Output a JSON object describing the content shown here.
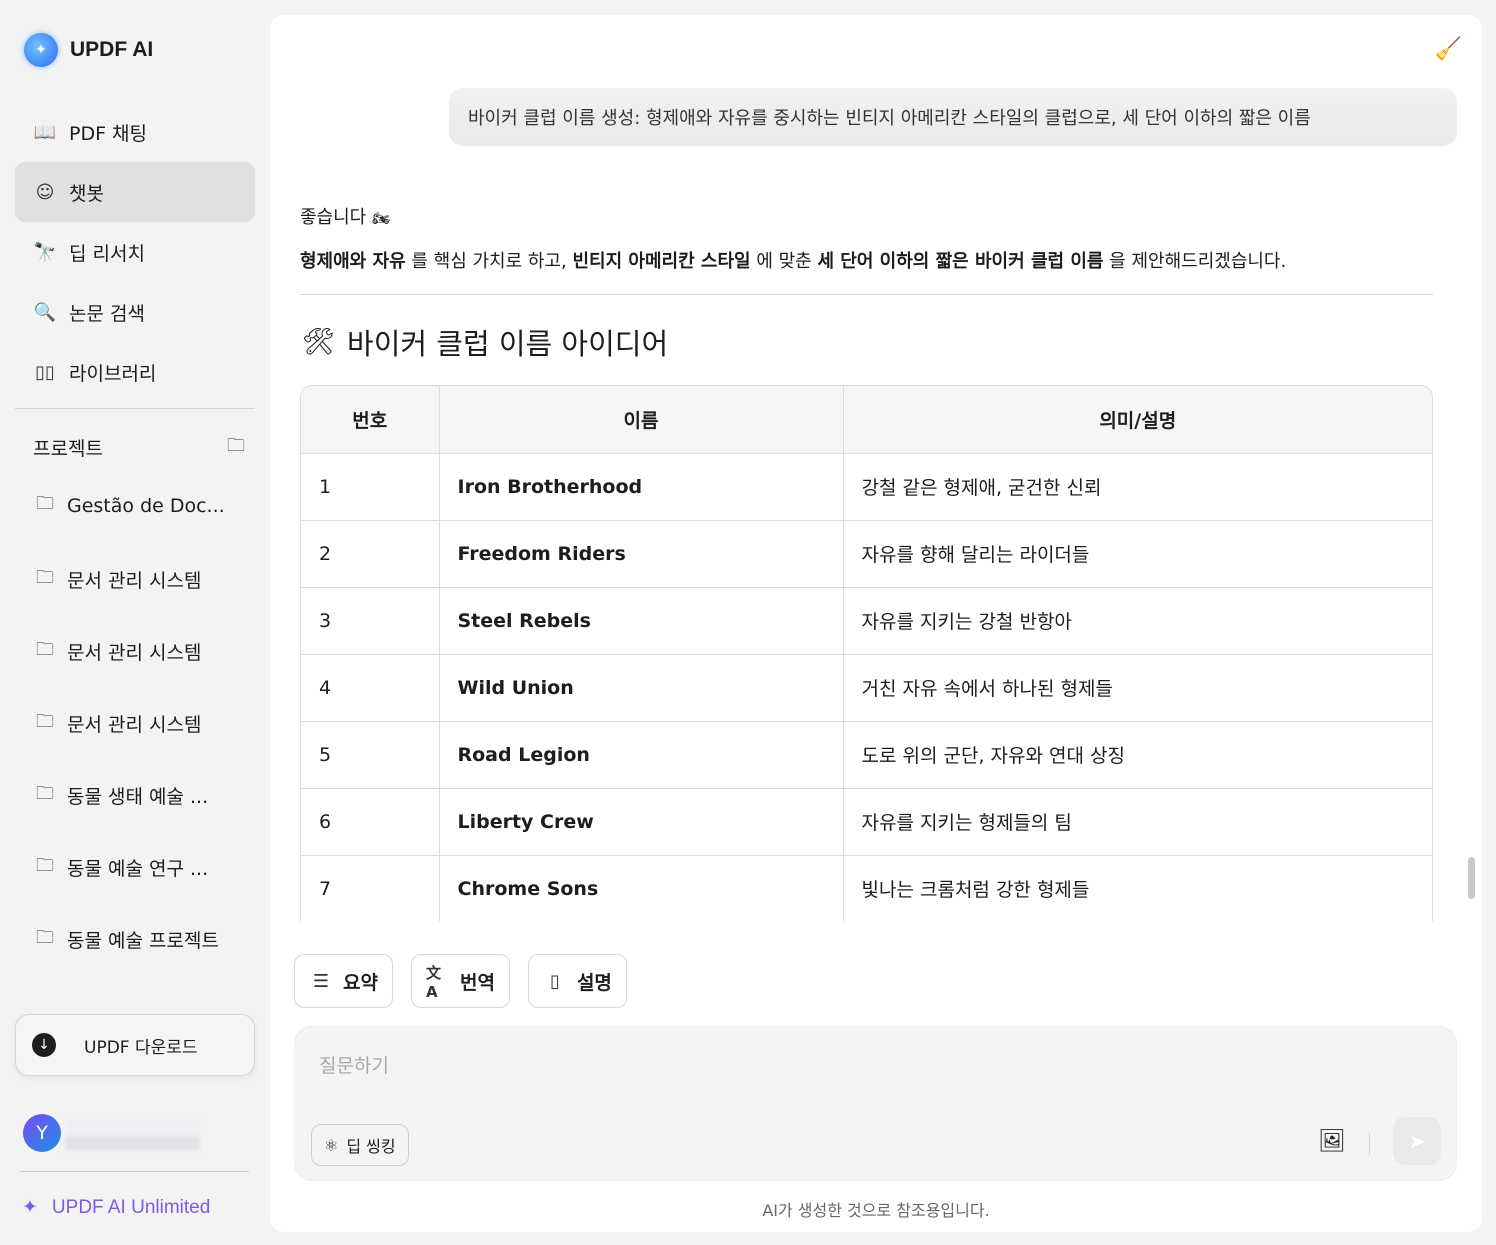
{
  "app": {
    "name": "UPDF AI"
  },
  "sidebar": {
    "nav": [
      {
        "label": "PDF 채팅",
        "icon": "book-sparkle-icon"
      },
      {
        "label": "챗봇",
        "icon": "chatbot-icon"
      },
      {
        "label": "딥 리서치",
        "icon": "telescope-icon"
      },
      {
        "label": "논문 검색",
        "icon": "doc-search-icon"
      },
      {
        "label": "라이브러리",
        "icon": "library-icon"
      }
    ],
    "projects_title": "프로젝트",
    "projects": [
      "Gestão de Doc...",
      "문서 관리 시스템",
      "문서 관리 시스템",
      "문서 관리 시스템",
      "동물 생태 예술 ...",
      "동물 예술 연구 ...",
      "동물 예술 프로젝트"
    ],
    "download_label": "UPDF 다운로드",
    "user_initial": "Y",
    "unlimited_label": "UPDF AI Unlimited",
    "accent": "#7b5ce6"
  },
  "chat": {
    "user_message": "바이커 클럽 이름 생성: 형제애와 자유를 중시하는 빈티지 아메리칸 스타일의 클럽으로, 세 단어 이하의 짧은 이름",
    "reply_intro": "좋습니다",
    "reply_emoji": "🏍",
    "reply_parts": {
      "b1": "형제애와 자유",
      "t1": " 를 핵심 가치로 하고, ",
      "b2": "빈티지 아메리칸 스타일",
      "t2": " 에 맞춘 ",
      "b3": "세 단어 이하의 짧은 바이커 클럽 이름",
      "t3": " 을 제안해드리겠습니다."
    },
    "heading_emoji": "🛠",
    "heading": "바이커 클럽 이름 아이디어",
    "table": {
      "headers": [
        "번호",
        "이름",
        "의미/설명"
      ],
      "rows": [
        [
          "1",
          "Iron Brotherhood",
          "강철 같은 형제애, 굳건한 신뢰"
        ],
        [
          "2",
          "Freedom Riders",
          "자유를 향해 달리는 라이더들"
        ],
        [
          "3",
          "Steel Rebels",
          "자유를 지키는 강철 반항아"
        ],
        [
          "4",
          "Wild Union",
          "거친 자유 속에서 하나된 형제들"
        ],
        [
          "5",
          "Road Legion",
          "도로 위의 군단, 자유와 연대 상징"
        ],
        [
          "6",
          "Liberty Crew",
          "자유를 지키는 형제들의 팀"
        ],
        [
          "7",
          "Chrome Sons",
          "빛나는 크롬처럼 강한 형제들"
        ]
      ]
    }
  },
  "actions": [
    {
      "label": "요약",
      "icon": "summary-icon"
    },
    {
      "label": "번역",
      "icon": "translate-icon"
    },
    {
      "label": "설명",
      "icon": "book-icon"
    }
  ],
  "input": {
    "placeholder": "질문하기",
    "deep_thinking": "딥 씽킹"
  },
  "footer": "AI가 생성한 것으로 참조용입니다."
}
